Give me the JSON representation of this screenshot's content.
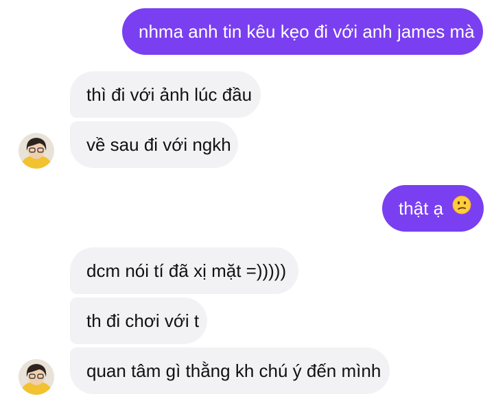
{
  "colors": {
    "outgoing_bubble": "#7a3ff0",
    "incoming_bubble": "#f2f2f5",
    "outgoing_text": "#ffffff",
    "incoming_text": "#111111"
  },
  "messages": [
    {
      "direction": "outgoing",
      "text": "nhma anh tin kêu kẹo đi với anh james mà"
    },
    {
      "direction": "incoming",
      "text": "thì đi với ảnh lúc đầu"
    },
    {
      "direction": "incoming",
      "text": "về sau đi với ngkh"
    },
    {
      "direction": "outgoing",
      "text": "thật ạ",
      "emoji": "confused-face-emoji"
    },
    {
      "direction": "incoming",
      "text": "dcm nói tí đã xị mặt =)))))"
    },
    {
      "direction": "incoming",
      "text": "th đi chơi với t"
    },
    {
      "direction": "incoming",
      "text": "quan tâm gì thằng kh chú ý đến mình"
    }
  ],
  "avatars": [
    {
      "icon": "user-avatar-photo"
    },
    {
      "icon": "user-avatar-photo"
    }
  ]
}
